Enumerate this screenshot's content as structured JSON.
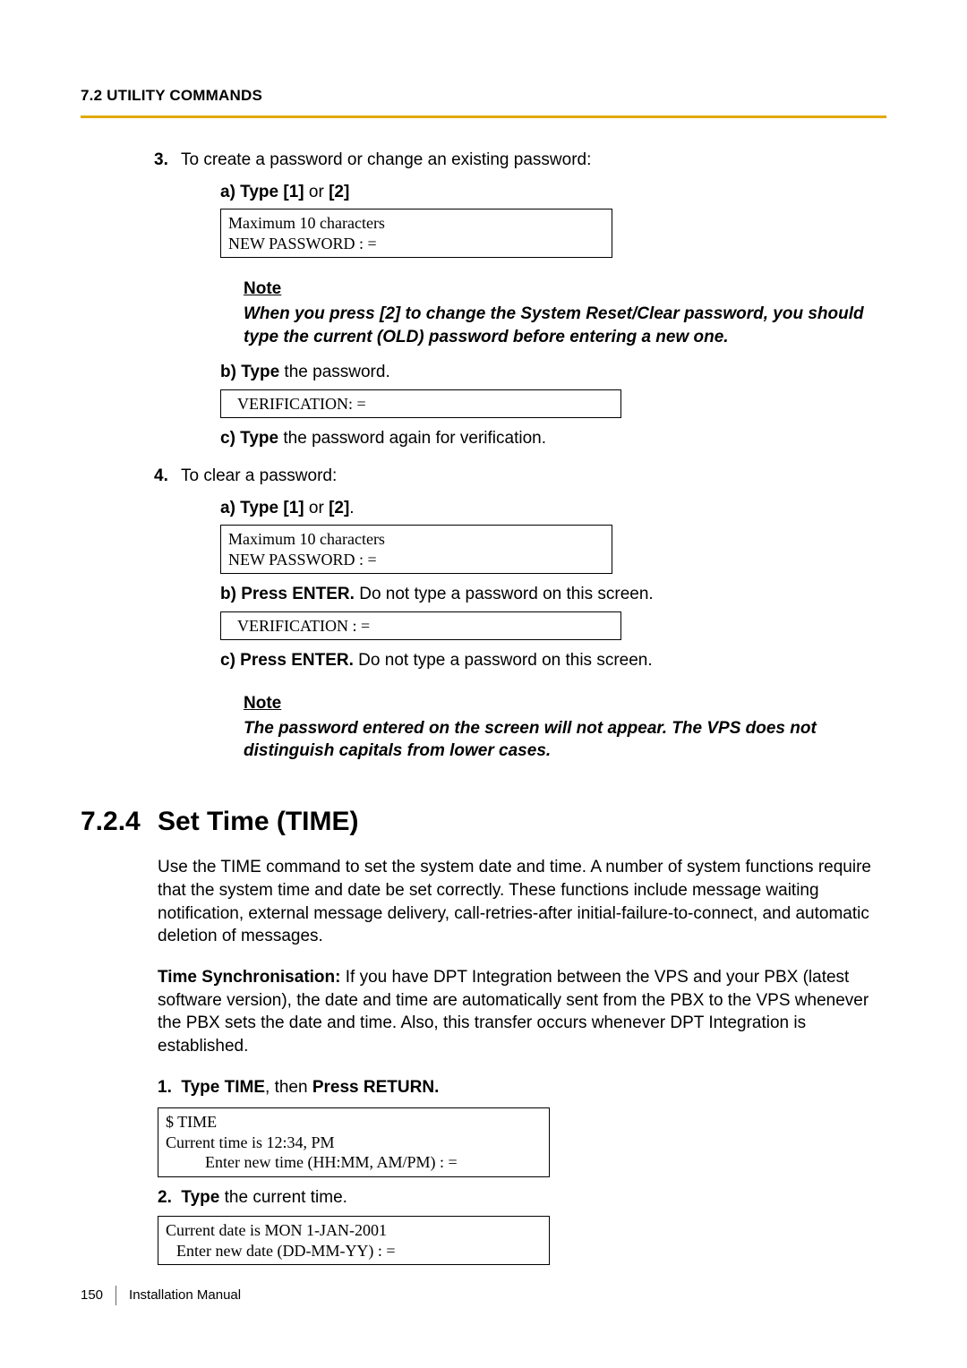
{
  "header": {
    "running": "7.2 UTILITY COMMANDS"
  },
  "step3": {
    "num": "3.",
    "intro": "To create a password or change an existing password:",
    "a_label": "a) Type [1] ",
    "a_or": "or",
    "a_tail": " [2]",
    "box1_l1": "Maximum 10 characters",
    "box1_l2": "NEW PASSWORD : =",
    "note_head": "Note",
    "note_body": "When you press [2] to change the System Reset/Clear password, you should type the current (OLD) password before entering a new one.",
    "b_label": "b) Type",
    "b_tail": " the password.",
    "box2": "VERIFICATION: =",
    "c_label": "c) Type",
    "c_tail": " the password again for verification."
  },
  "step4": {
    "num": "4.",
    "intro": "To clear a password:",
    "a_label": "a) Type [1] ",
    "a_or": "or",
    "a_tail": " [2]",
    "a_period": ".",
    "box1_l1": "Maximum 10 characters",
    "box1_l2": "NEW PASSWORD : =",
    "b_label": "b) Press ENTER.",
    "b_tail": " Do not type a password on this screen.",
    "box2": "VERIFICATION : =",
    "c_label": "c) Press ENTER.",
    "c_tail": " Do not type a password on this screen.",
    "note_head": "Note",
    "note_body": "The password entered on the screen will not appear. The VPS does not distinguish capitals from lower cases."
  },
  "section": {
    "num": "7.2.4",
    "title": "Set Time (TIME)",
    "p1": "Use the TIME command to set the system date and time. A number of system functions require that the system time and date be set correctly. These functions include message waiting notification, external message delivery, call-retries-after initial-failure-to-connect, and automatic deletion of messages.",
    "p2_lead": "Time Synchronisation:",
    "p2_tail": " If you have DPT Integration between the VPS and your PBX (latest software version), the date and time are automatically sent from the PBX to the VPS whenever the PBX sets the date and time. Also, this transfer occurs whenever DPT Integration is established.",
    "s1_num": "1.",
    "s1_a": "Type TIME",
    "s1_mid": ", then ",
    "s1_b": "Press RETURN.",
    "box1_l1": "$  TIME",
    "box1_l2": "Current time is 12:34, PM",
    "box1_l3": "Enter new time (HH:MM, AM/PM) : =",
    "s2_num": "2.",
    "s2_a": "Type",
    "s2_tail": " the current time.",
    "box2_l1": "Current date is MON 1-JAN-2001",
    "box2_l2": "Enter new date (DD-MM-YY) : ="
  },
  "footer": {
    "page": "150",
    "label": "Installation Manual"
  }
}
